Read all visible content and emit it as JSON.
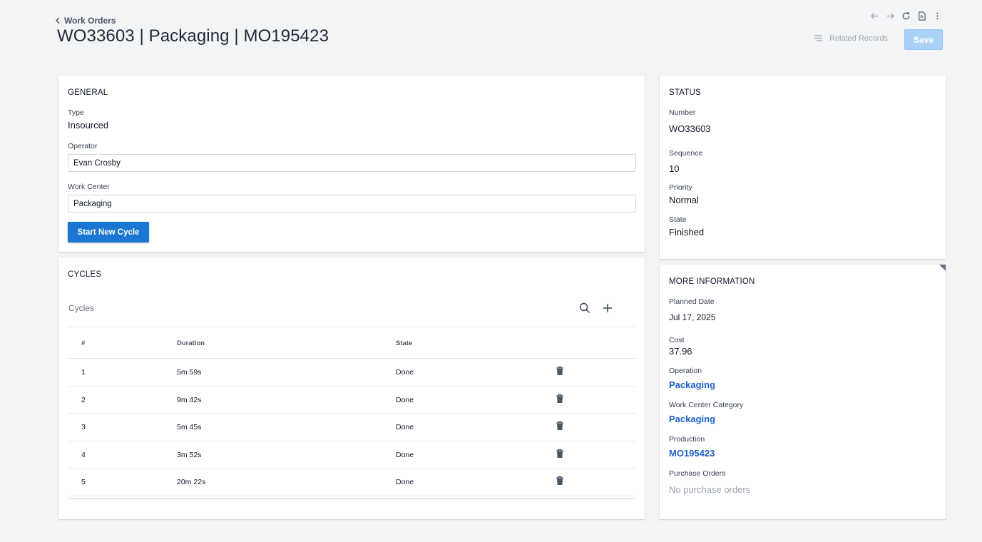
{
  "header": {
    "back_label": "Work Orders",
    "title": "WO33603 | Packaging | MO195423",
    "related_label": "Related Records",
    "save_label": "Save"
  },
  "general": {
    "title": "GENERAL",
    "type_label": "Type",
    "type_value": "Insourced",
    "operator_label": "Operator",
    "operator_value": "Evan Crosby",
    "work_center_label": "Work Center",
    "work_center_value": "Packaging",
    "start_cycle_label": "Start New Cycle"
  },
  "cycles": {
    "title": "CYCLES",
    "grid_label": "Cycles",
    "columns": [
      "#",
      "Duration",
      "State"
    ],
    "rows": [
      {
        "num": "1",
        "duration": "5m 59s",
        "state": "Done"
      },
      {
        "num": "2",
        "duration": "9m 42s",
        "state": "Done"
      },
      {
        "num": "3",
        "duration": "5m 45s",
        "state": "Done"
      },
      {
        "num": "4",
        "duration": "3m 52s",
        "state": "Done"
      },
      {
        "num": "5",
        "duration": "20m 22s",
        "state": "Done"
      }
    ]
  },
  "status": {
    "title": "STATUS",
    "number_label": "Number",
    "number_value": "WO33603",
    "sequence_label": "Sequence",
    "sequence_value": "10",
    "priority_label": "Priority",
    "priority_value": "Normal",
    "state_label": "State",
    "state_value": "Finished"
  },
  "more_info": {
    "title": "MORE INFORMATION",
    "planned_date_label": "Planned Date",
    "planned_date_value": "Jul 17, 2025",
    "cost_label": "Cost",
    "cost_value": "37.96",
    "operation_label": "Operation",
    "operation_value": "Packaging",
    "wc_category_label": "Work Center Category",
    "wc_category_value": "Packaging",
    "production_label": "Production",
    "production_value": "MO195423",
    "purchase_orders_label": "Purchase Orders",
    "purchase_orders_value": "No purchase orders"
  },
  "colors": {
    "primary": "#1976d2",
    "link": "#1d5fc9",
    "save_disabled": "#a8d1f5",
    "background": "#f3f4f6"
  }
}
